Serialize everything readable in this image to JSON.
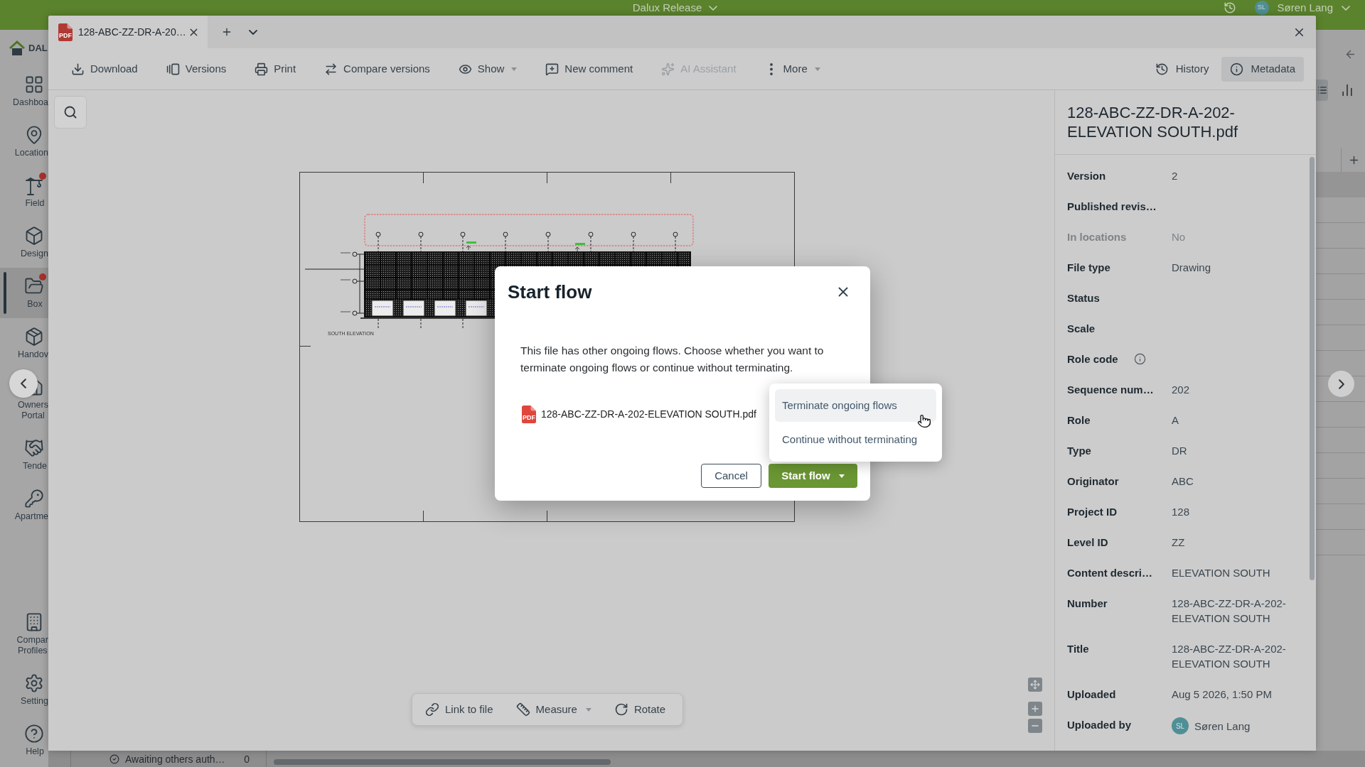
{
  "header": {
    "project": "Dalux Release",
    "user_initials": "SL",
    "user_name": "Søren Lang"
  },
  "sidebar": {
    "logo": "DAL",
    "top_items": [
      {
        "label": "Dashboa",
        "selected": false,
        "badge": false
      },
      {
        "label": "Location",
        "selected": false,
        "badge": false
      },
      {
        "label": "Field",
        "selected": false,
        "badge": true
      },
      {
        "label": "Design",
        "selected": false,
        "badge": false
      },
      {
        "label": "Box",
        "selected": true,
        "badge": true
      },
      {
        "label": "Handov",
        "selected": false,
        "badge": false
      },
      {
        "label": "Owners Portal",
        "selected": false,
        "badge": false
      },
      {
        "label": "Tende",
        "selected": false,
        "badge": false
      },
      {
        "label": "Apartme",
        "selected": false,
        "badge": false
      }
    ],
    "bottom_items": [
      {
        "label": "Compar Profiles",
        "selected": false,
        "badge": false
      },
      {
        "label": "Setting",
        "selected": false,
        "badge": false
      },
      {
        "label": "Help",
        "selected": false,
        "badge": false
      }
    ]
  },
  "viewer": {
    "tab": {
      "title": "128-ABC-ZZ-DR-A-20…",
      "file_badge": "PDF"
    },
    "toolbar": [
      {
        "label": "Download",
        "has_menu": false,
        "disabled": false
      },
      {
        "label": "Versions",
        "has_menu": false,
        "disabled": false
      },
      {
        "label": "Print",
        "has_menu": false,
        "disabled": false
      },
      {
        "label": "Compare versions",
        "has_menu": false,
        "disabled": false
      },
      {
        "label": "Show",
        "has_menu": true,
        "disabled": false
      },
      {
        "label": "New comment",
        "has_menu": false,
        "disabled": false
      },
      {
        "label": "AI Assistant",
        "has_menu": false,
        "disabled": true
      },
      {
        "label": "More",
        "has_menu": true,
        "disabled": false
      }
    ],
    "panel_toggles": [
      {
        "label": "History",
        "selected": false
      },
      {
        "label": "Metadata",
        "selected": true
      }
    ],
    "drawing": {
      "caption": "SOUTH ELEVATION"
    },
    "canvas_tools": [
      {
        "label": "Link to file",
        "has_menu": false
      },
      {
        "label": "Measure",
        "has_menu": true
      },
      {
        "label": "Rotate",
        "has_menu": false
      }
    ],
    "metadata": {
      "title": "128-ABC-ZZ-DR-A-202-ELEVATION SOUTH.pdf",
      "fields": [
        {
          "kind": "text",
          "label": "Version",
          "value": "2",
          "disabled": false,
          "info": false
        },
        {
          "kind": "text",
          "label": "Published revis…",
          "disabled": false,
          "info": false
        },
        {
          "kind": "text",
          "label": "In locations",
          "value": "No",
          "disabled": true,
          "info": false
        },
        {
          "kind": "text",
          "label": "File type",
          "value": "Drawing",
          "disabled": false,
          "info": false
        },
        {
          "kind": "text",
          "label": "Status",
          "disabled": false,
          "info": false
        },
        {
          "kind": "text",
          "label": "Scale",
          "disabled": false,
          "info": false
        },
        {
          "kind": "text",
          "label": "Role code",
          "disabled": false,
          "info": true
        },
        {
          "kind": "text",
          "label": "Sequence num…",
          "value": "202",
          "disabled": false,
          "info": false
        },
        {
          "kind": "text",
          "label": "Role",
          "value": "A",
          "disabled": false,
          "info": false
        },
        {
          "kind": "text",
          "label": "Type",
          "value": "DR",
          "disabled": false,
          "info": false
        },
        {
          "kind": "text",
          "label": "Originator",
          "value": "ABC",
          "disabled": false,
          "info": false
        },
        {
          "kind": "text",
          "label": "Project ID",
          "value": "128",
          "disabled": false,
          "info": false
        },
        {
          "kind": "text",
          "label": "Level ID",
          "value": "ZZ",
          "disabled": false,
          "info": false
        },
        {
          "kind": "text",
          "label": "Content descri…",
          "value": "ELEVATION SOUTH",
          "disabled": false,
          "info": false
        },
        {
          "kind": "text",
          "label": "Number",
          "value": "128-ABC-ZZ-DR-A-202-ELEVATION SOUTH",
          "disabled": false,
          "info": false
        },
        {
          "kind": "text",
          "label": "Title",
          "value": "128-ABC-ZZ-DR-A-202-ELEVATION SOUTH",
          "disabled": false,
          "info": false
        },
        {
          "kind": "text",
          "label": "Uploaded",
          "value": "Aug 5 2026, 1:50 PM",
          "disabled": false,
          "info": false
        },
        {
          "kind": "user",
          "label": "Uploaded by",
          "value": "Søren Lang",
          "initials": "SL",
          "disabled": false,
          "info": false
        }
      ]
    }
  },
  "dialog": {
    "title": "Start flow",
    "message": "This file has other ongoing flows. Choose whether you want to terminate ongoing flows or continue without terminating.",
    "file": "128-ABC-ZZ-DR-A-202-ELEVATION SOUTH.pdf",
    "file_badge": "PDF",
    "buttons": [
      {
        "label": "Cancel",
        "kind": "secondary",
        "has_menu": false
      },
      {
        "label": "Start flow",
        "kind": "primary",
        "has_menu": true
      }
    ],
    "menu": [
      {
        "label": "Terminate ongoing flows",
        "selected": true
      },
      {
        "label": "Continue without terminating",
        "selected": false
      }
    ]
  },
  "status_bar": {
    "label": "Awaiting others auth…",
    "count": "0"
  }
}
